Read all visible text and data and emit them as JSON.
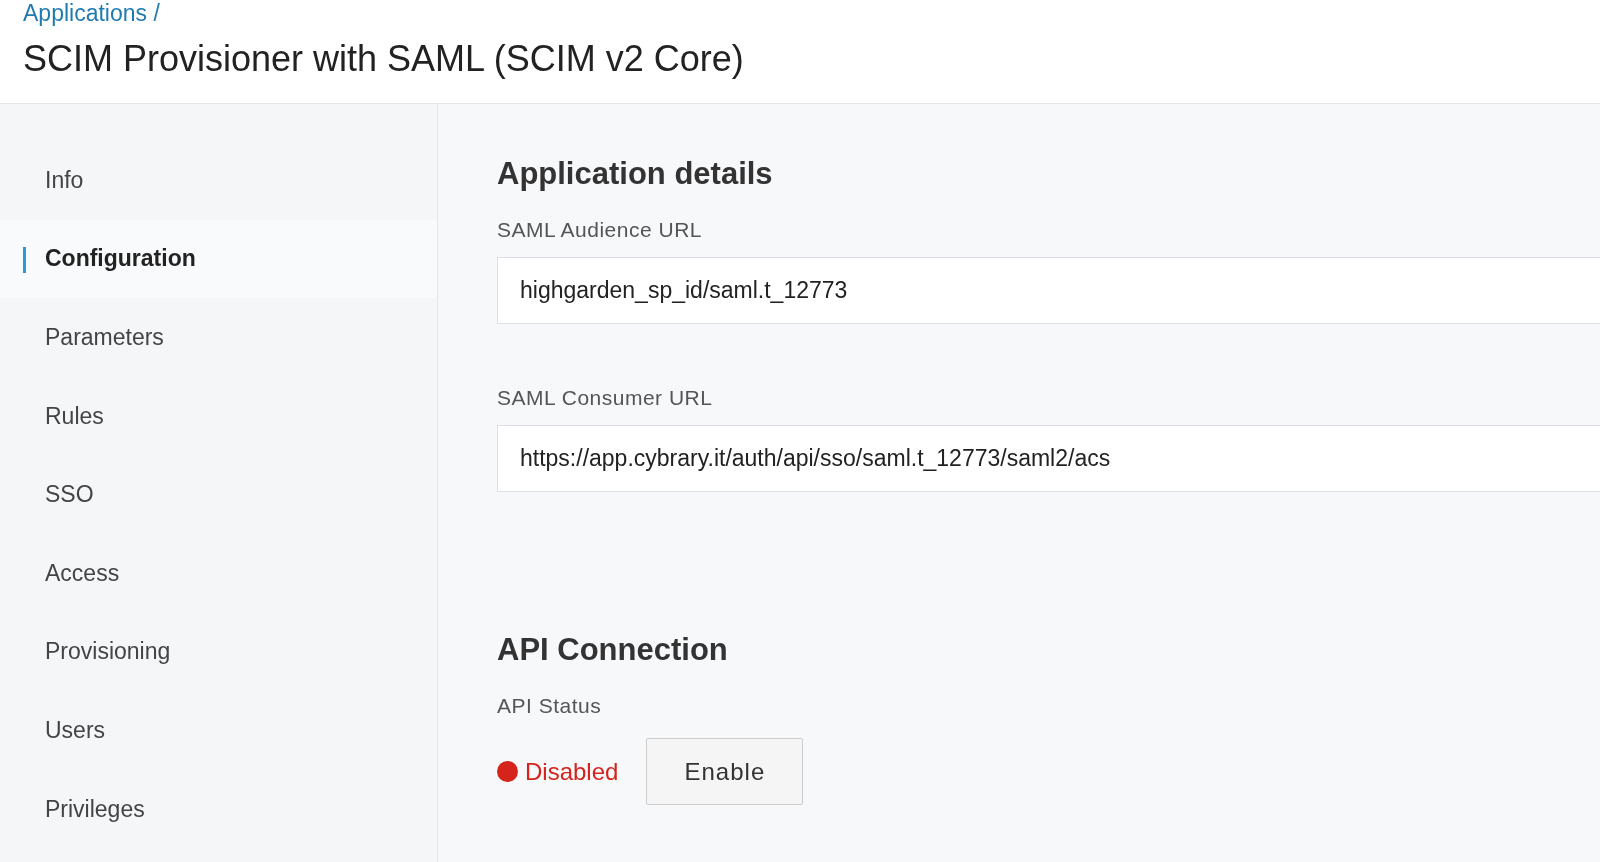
{
  "breadcrumb": "Applications /",
  "title": "SCIM Provisioner with SAML (SCIM v2 Core)",
  "sidebar": {
    "items": [
      {
        "label": "Info",
        "selected": false
      },
      {
        "label": "Configuration",
        "selected": true
      },
      {
        "label": "Parameters",
        "selected": false
      },
      {
        "label": "Rules",
        "selected": false
      },
      {
        "label": "SSO",
        "selected": false
      },
      {
        "label": "Access",
        "selected": false
      },
      {
        "label": "Provisioning",
        "selected": false
      },
      {
        "label": "Users",
        "selected": false
      },
      {
        "label": "Privileges",
        "selected": false
      }
    ]
  },
  "application_details": {
    "heading": "Application details",
    "fields": [
      {
        "label": "SAML Audience URL",
        "value": "highgarden_sp_id/saml.t_12773"
      },
      {
        "label": "SAML Consumer URL",
        "value": "https://app.cybrary.it/auth/api/sso/saml.t_12773/saml2/acs"
      }
    ]
  },
  "api_connection": {
    "heading": "API Connection",
    "status_label": "API Status",
    "status": {
      "text": "Disabled",
      "enabled": false
    },
    "button": "Enable"
  }
}
